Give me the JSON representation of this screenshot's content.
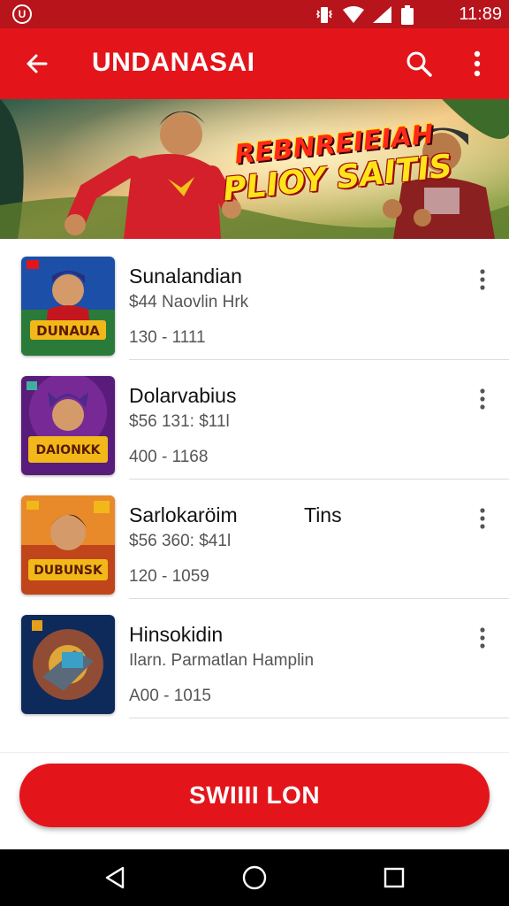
{
  "status_bar": {
    "time": "11:89",
    "icons": [
      "app-logo-icon",
      "vibrate-icon",
      "wifi-icon",
      "signal-icon",
      "battery-icon"
    ],
    "logo_text": "U"
  },
  "app_bar": {
    "title": "UNDANASAI",
    "icons": [
      "back-arrow-icon",
      "search-icon",
      "more-vert-icon"
    ],
    "color": "#e3151b"
  },
  "banner": {
    "line1": "REBNREIEIAH",
    "line2": "PLIOY SAITIS"
  },
  "list": {
    "items": [
      {
        "title": "Sunalandian",
        "subtitle": "$44  Naovlin Hrk",
        "range": "130 - 1111",
        "tag": "",
        "thumb_text": "DUNAUA"
      },
      {
        "title": "Dolarvabius",
        "subtitle": "$56 131: $11l",
        "range": "400 - 1168",
        "tag": "",
        "thumb_text": "DAIONKK"
      },
      {
        "title": "Sarlokaröim",
        "subtitle": "$56 360: $41l",
        "range": "120 - 1059",
        "tag": "Tins",
        "thumb_text": "DUBUNSK"
      },
      {
        "title": "Hinsokidin",
        "subtitle": "Ilarn. Parmatlan Hamplin",
        "range": "A00 - 1015",
        "tag": "",
        "thumb_text": ""
      }
    ]
  },
  "cta": {
    "label": "SWIIII LON",
    "color": "#e3151b"
  },
  "nav_bar": {
    "icons": [
      "nav-back-icon",
      "nav-home-icon",
      "nav-recents-icon"
    ]
  }
}
